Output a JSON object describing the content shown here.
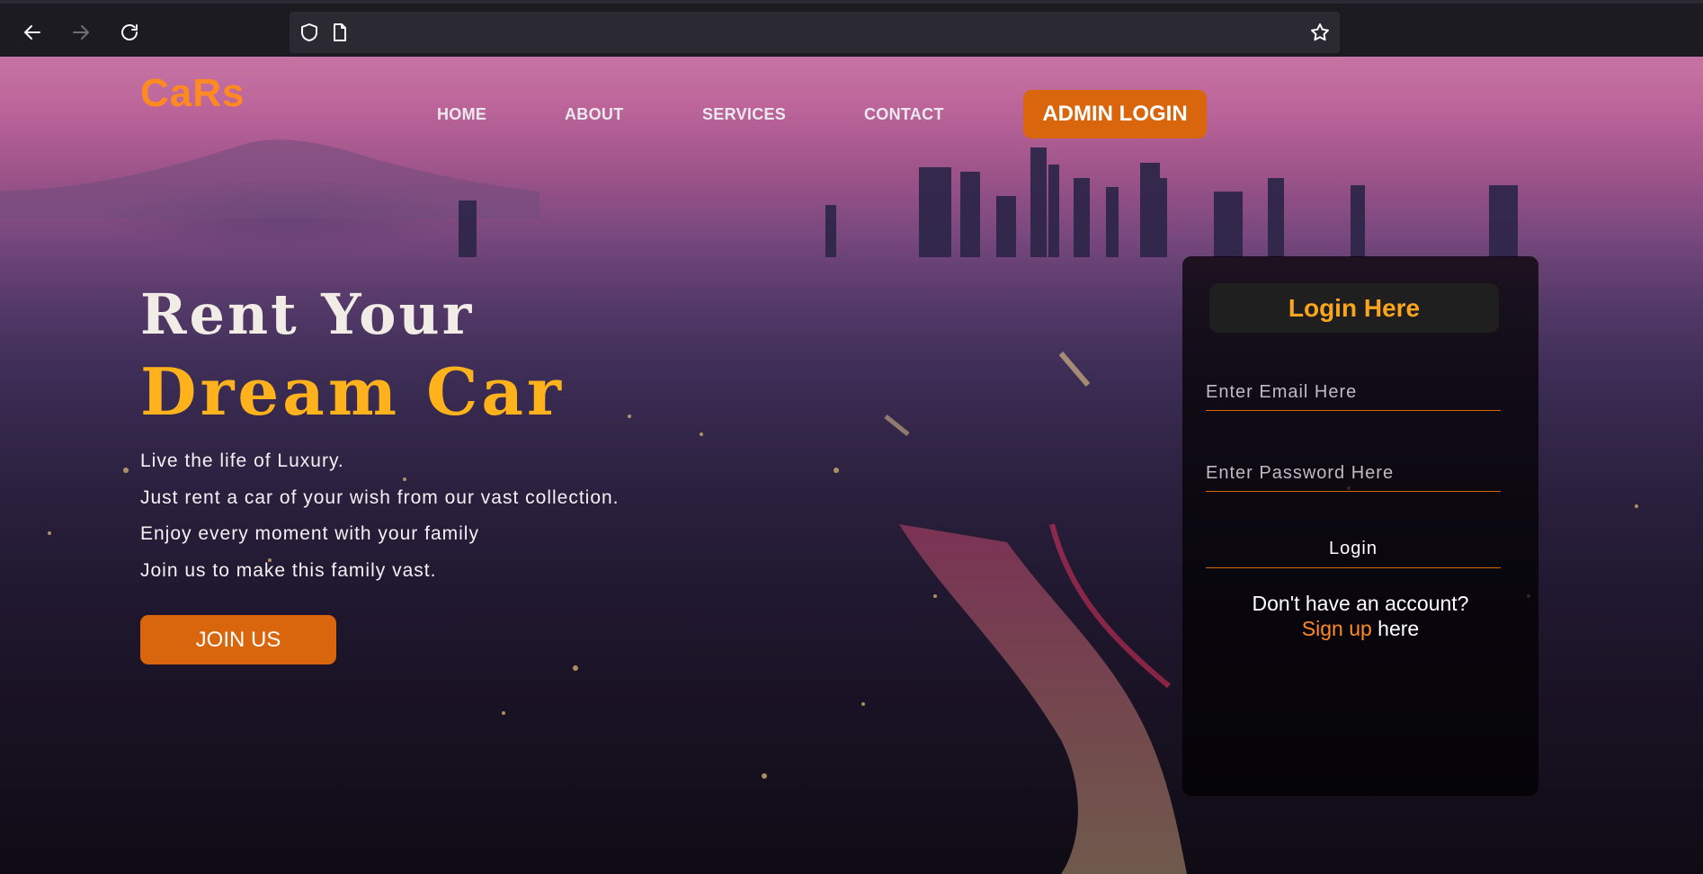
{
  "browser": {
    "back_icon": "arrow-left-icon",
    "forward_icon": "arrow-right-icon",
    "reload_icon": "reload-icon",
    "shield_icon": "shield-icon",
    "page_icon": "page-icon",
    "star_icon": "star-icon",
    "url": ""
  },
  "header": {
    "logo": "CaRs",
    "nav": [
      "HOME",
      "ABOUT",
      "SERVICES",
      "CONTACT"
    ],
    "admin_button": "ADMIN LOGIN"
  },
  "hero": {
    "title_line1": "Rent Your",
    "title_line2": "Dream Car",
    "lines": [
      "Live the life of Luxury.",
      "Just rent a car of your wish from our vast collection.",
      "Enjoy every moment with your family",
      "Join us to make this family vast."
    ],
    "join_button": "JOIN US"
  },
  "login": {
    "title": "Login Here",
    "email_placeholder": "Enter Email Here",
    "password_placeholder": "Enter Password Here",
    "login_button": "Login",
    "signup_prefix": "Don't have an account?",
    "signup_link": "Sign up",
    "signup_suffix": " here"
  },
  "colors": {
    "accent": "#d9650d",
    "logo": "#ff8a1f",
    "hero_highlight": "#ffb21c",
    "card_title": "#f9a51e"
  }
}
